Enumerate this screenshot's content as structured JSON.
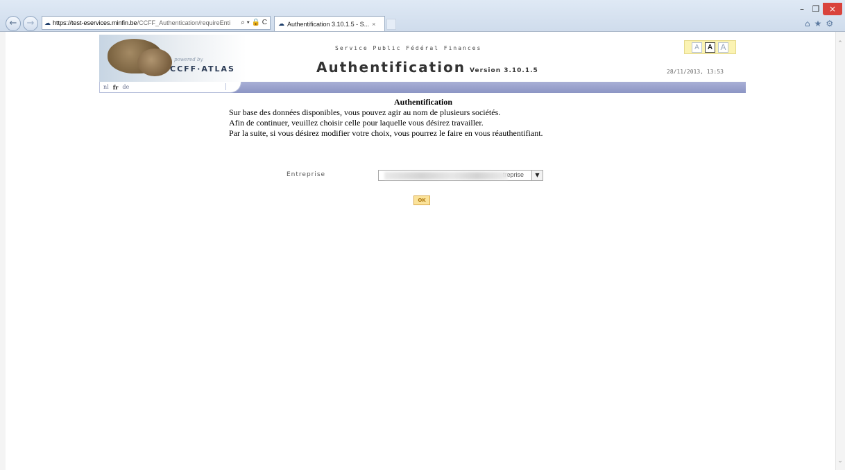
{
  "browser": {
    "url_host": "https://test-eservices.minfin.be",
    "url_path": "/CCFF_Authentication/requireEnti",
    "tab_title": "Authentification 3.10.1.5 - S...",
    "address_tools": "⌕ ▾ 🔒 C"
  },
  "header": {
    "powered_by": "powered by",
    "logo_text": "CCFF·ATLAS",
    "service": "Service Public Fédéral Finances",
    "title": "Authentification",
    "version": "Version 3.10.1.5",
    "date": "28/11/2013, 13:53",
    "font_sizes": [
      "A",
      "A",
      "A"
    ],
    "languages": [
      "nl",
      "fr",
      "de"
    ]
  },
  "content": {
    "title": "Authentification",
    "lines": [
      "Sur base des données disponibles, vous pouvez agir au nom de plusieurs sociétés.",
      "Afin de continuer, veuillez choisir celle pour laquelle vous désirez travailler.",
      "Par la suite, si vous désirez modifier votre choix, vous pourrez le faire en vous réauthentifiant."
    ],
    "field_label": "Entreprise",
    "select_value": "treprise",
    "ok_label": "OK"
  }
}
